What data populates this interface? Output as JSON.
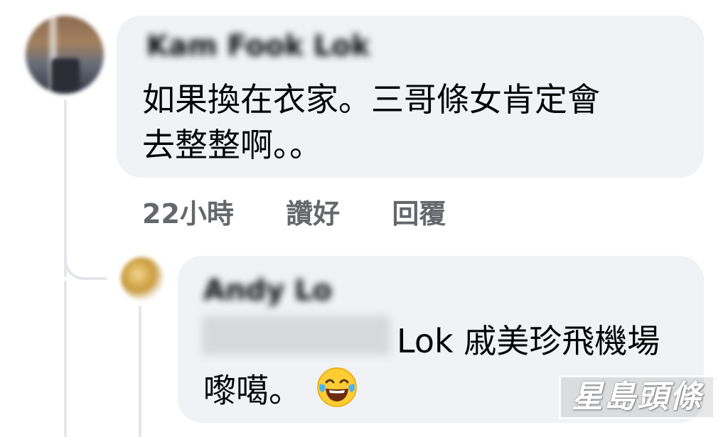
{
  "comment": {
    "author": "Kam Fook Lok",
    "text_line1": "如果換在衣家。三哥條女肯定會",
    "text_line2": "去整整啊。。",
    "time": "22小時",
    "like_label": "讚好",
    "reply_label": "回覆"
  },
  "reply": {
    "author": "Andy Lo",
    "mention": "Kam Fook Lok",
    "text_line1": "Lok 戚美珍飛機場",
    "text_line2": "嚟噶。",
    "emoji": "face-with-tears-of-joy"
  },
  "watermark": {
    "text": "星島頭條"
  }
}
